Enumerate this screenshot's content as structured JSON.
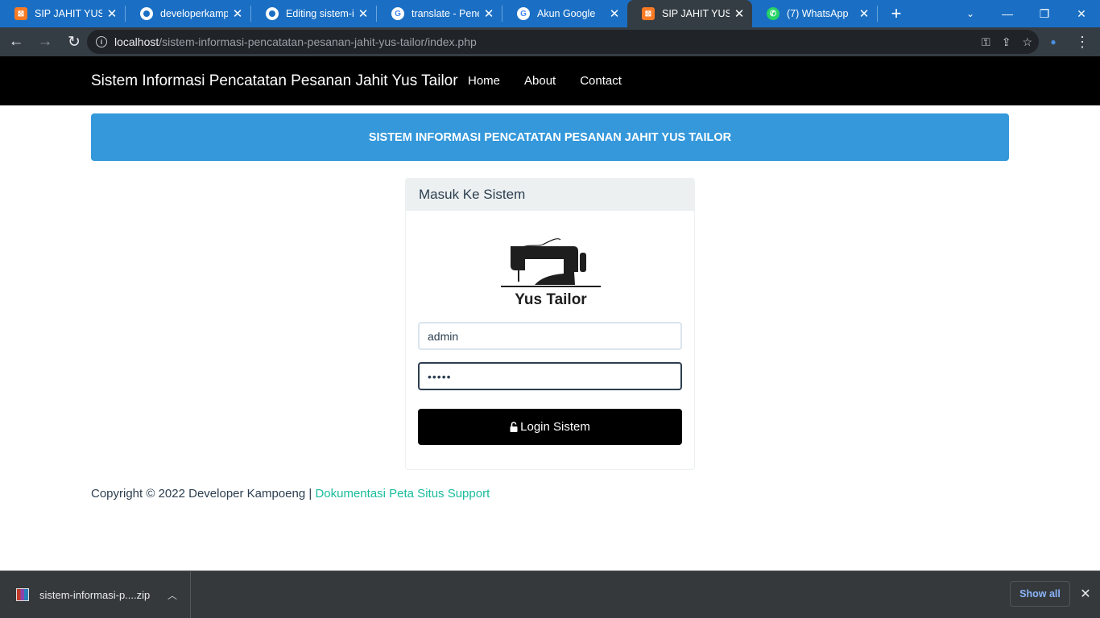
{
  "browser": {
    "tabs": [
      {
        "title": "SIP JAHIT YUS TAILOR",
        "favicon": "xampp-icon",
        "active": false
      },
      {
        "title": "developerkampoeng",
        "favicon": "github-icon",
        "active": false
      },
      {
        "title": "Editing sistem-informasi",
        "favicon": "github-icon",
        "active": false
      },
      {
        "title": "translate - Penelusuran",
        "favicon": "google-icon",
        "active": false
      },
      {
        "title": "Akun Google",
        "favicon": "google-icon",
        "active": false
      },
      {
        "title": "SIP JAHIT YUS TAILOR",
        "favicon": "xampp-icon",
        "active": true
      },
      {
        "title": "(7) WhatsApp",
        "favicon": "whatsapp-icon",
        "active": false
      }
    ],
    "url_host": "localhost",
    "url_path": "/sistem-informasi-pencatatan-pesanan-jahit-yus-tailor/index.php"
  },
  "navbar": {
    "brand": "Sistem Informasi Pencatatan Pesanan Jahit Yus Tailor",
    "links": [
      "Home",
      "About",
      "Contact"
    ]
  },
  "banner": {
    "text": "SISTEM INFORMASI PENCATATAN PESANAN JAHIT YUS TAILOR"
  },
  "login": {
    "heading": "Masuk Ke Sistem",
    "logo_text": "Yus Tailor",
    "username_value": "admin",
    "password_value": "•••••",
    "button_label": "Login Sistem"
  },
  "footer": {
    "copyright": "Copyright © 2022 Developer Kampoeng | ",
    "link_text": "Dokumentasi Peta Situs Support"
  },
  "download_bar": {
    "file_name": "sistem-informasi-p....zip",
    "show_all_label": "Show all"
  },
  "colors": {
    "tabstrip": "#1a6fc4",
    "navbar": "#000000",
    "banner": "#3498db",
    "footer_link": "#18bc9c"
  }
}
